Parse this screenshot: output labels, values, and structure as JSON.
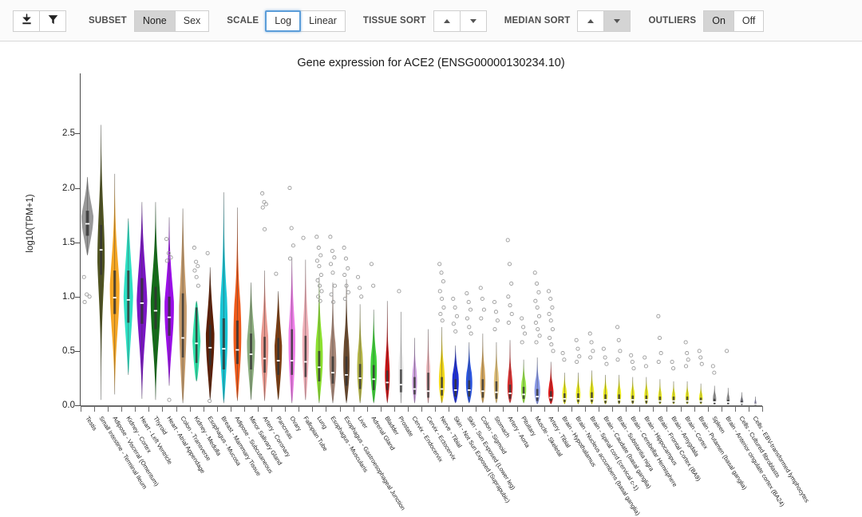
{
  "toolbar": {
    "download_icon": "download-icon",
    "filter_icon": "filter-funnel-icon",
    "subset_label": "SUBSET",
    "subset_options": [
      "None",
      "Sex"
    ],
    "subset_selected": "None",
    "scale_label": "SCALE",
    "scale_options": [
      "Log",
      "Linear"
    ],
    "scale_selected": "Log",
    "tissue_sort_label": "TISSUE SORT",
    "tissue_sort_up": "sort-ascending-icon",
    "tissue_sort_down": "sort-descending-icon",
    "tissue_sort_selected": "none",
    "median_sort_label": "MEDIAN SORT",
    "median_sort_up": "sort-ascending-icon",
    "median_sort_down": "sort-descending-icon",
    "median_sort_selected": "down",
    "outliers_label": "OUTLIERS",
    "outliers_options": [
      "On",
      "Off"
    ],
    "outliers_selected": "On"
  },
  "chart_data": {
    "type": "violin",
    "title": "Gene expression for ACE2 (ENSG00000130234.10)",
    "xlabel": "",
    "ylabel": "log10(TPM+1)",
    "ylim": [
      0.0,
      2.65
    ],
    "yticks": [
      "0.0",
      "0.5",
      "1.0",
      "1.5",
      "2.0",
      "2.5"
    ],
    "ytick_values": [
      0.0,
      0.5,
      1.0,
      1.5,
      2.0,
      2.5
    ],
    "grid": false,
    "legend": "none",
    "sort": "median descending",
    "categories": [
      "Testis",
      "Small Intestine - Terminal Ileum",
      "Adipose - Visceral (Omentum)",
      "Kidney - Cortex",
      "Heart - Left Ventricle",
      "Thyroid",
      "Heart - Atrial Appendage",
      "Colon - Transverse",
      "Kidney - Medulla",
      "Esophagus - Mucosa",
      "Breast - Mammary Tissue",
      "Adipose - Subcutaneous",
      "Minor Salivary Gland",
      "Artery - Coronary",
      "Pancreas",
      "Ovary",
      "Fallopian Tube",
      "Lung",
      "Esophagus - Muscularis",
      "Esophagus - Gastroesophageal Junction",
      "Liver",
      "Adrenal Gland",
      "Bladder",
      "Prostate",
      "Cervix - Endocervix",
      "Cervix - Ectocervix",
      "Nerve - Tibial",
      "Skin - Not Sun Exposed (Suprapubic)",
      "Skin - Sun Exposed (Lower leg)",
      "Colon - Sigmoid",
      "Stomach",
      "Artery - Aorta",
      "Pituitary",
      "Muscle - Skeletal",
      "Artery - Tibial",
      "Brain - Hypothalamus",
      "Brain - Nucleus accumbens (basal ganglia)",
      "Brain - Spinal cord (cervical c-1)",
      "Brain - Caudate (basal ganglia)",
      "Brain - Substantia nigra",
      "Brain - Cerebellar Hemisphere",
      "Brain - Hippocampus",
      "Brain - Frontal Cortex (BA9)",
      "Brain - Amygdala",
      "Brain - Cortex",
      "Brain - Putamen (basal ganglia)",
      "Spleen",
      "Brain - Anterior cingulate cortex (BA24)",
      "Cells - Cultured fibroblasts",
      "Cells - EBV-transformed lymphocytes"
    ],
    "series": [
      {
        "name": "Testis",
        "color": "#999999",
        "median": 1.67,
        "q1": 1.56,
        "q3": 1.79,
        "min": 1.38,
        "max": 2.1,
        "width": 0.5,
        "outliers": [
          1.18,
          1.02,
          1.0,
          0.95
        ]
      },
      {
        "name": "Small Intestine - Terminal Ileum",
        "color": "#4f5320",
        "median": 1.43,
        "q1": 1.2,
        "q3": 1.66,
        "min": 0.05,
        "max": 2.58,
        "width": 0.3,
        "outliers": []
      },
      {
        "name": "Adipose - Visceral (Omentum)",
        "color": "#f6a623",
        "median": 0.99,
        "q1": 0.84,
        "q3": 1.24,
        "min": 0.1,
        "max": 2.13,
        "width": 0.4,
        "outliers": []
      },
      {
        "name": "Kidney - Cortex",
        "color": "#2ee0c4",
        "median": 0.97,
        "q1": 0.76,
        "q3": 1.24,
        "min": 0.28,
        "max": 1.72,
        "width": 0.38,
        "outliers": []
      },
      {
        "name": "Heart - Left Ventricle",
        "color": "#7a16c4",
        "median": 0.94,
        "q1": 0.75,
        "q3": 1.17,
        "min": 0.06,
        "max": 1.87,
        "width": 0.42,
        "outliers": []
      },
      {
        "name": "Thyroid",
        "color": "#136d18",
        "median": 0.87,
        "q1": 0.7,
        "q3": 1.09,
        "min": 0.05,
        "max": 1.87,
        "width": 0.4,
        "outliers": []
      },
      {
        "name": "Heart - Atrial Appendage",
        "color": "#9b0fe8",
        "median": 0.81,
        "q1": 0.64,
        "q3": 1.0,
        "min": 0.18,
        "max": 1.73,
        "width": 0.4,
        "outliers": [
          1.53,
          1.4,
          1.36,
          1.33,
          0.05
        ]
      },
      {
        "name": "Colon - Transverse",
        "color": "#c49a6b",
        "median": 0.62,
        "q1": 0.44,
        "q3": 1.03,
        "min": 0.02,
        "max": 1.81,
        "width": 0.34,
        "outliers": []
      },
      {
        "name": "Kidney - Medulla",
        "color": "#30e0a8",
        "median": 0.57,
        "q1": 0.39,
        "q3": 0.9,
        "min": 0.22,
        "max": 0.96,
        "width": 0.32,
        "outliers": [
          1.45,
          1.32,
          1.28,
          1.24,
          1.18,
          1.1
        ]
      },
      {
        "name": "Esophagus - Mucosa",
        "color": "#5a1f06",
        "median": 0.53,
        "q1": 0.37,
        "q3": 0.74,
        "min": 0.05,
        "max": 1.27,
        "width": 0.36,
        "outliers": [
          1.4,
          0.04
        ]
      },
      {
        "name": "Breast - Mammary Tissue",
        "color": "#19c5d4",
        "median": 0.52,
        "q1": 0.33,
        "q3": 0.8,
        "min": 0.02,
        "max": 1.96,
        "width": 0.4,
        "outliers": []
      },
      {
        "name": "Adipose - Subcutaneous",
        "color": "#ef5a1a",
        "median": 0.51,
        "q1": 0.38,
        "q3": 0.78,
        "min": 0.04,
        "max": 1.82,
        "width": 0.4,
        "outliers": []
      },
      {
        "name": "Minor Salivary Gland",
        "color": "#8aab7c",
        "median": 0.47,
        "q1": 0.33,
        "q3": 0.66,
        "min": 0.05,
        "max": 1.13,
        "width": 0.34,
        "outliers": []
      },
      {
        "name": "Artery - Coronary",
        "color": "#e99a90",
        "median": 0.43,
        "q1": 0.3,
        "q3": 0.63,
        "min": 0.04,
        "max": 1.24,
        "width": 0.34,
        "outliers": [
          1.95,
          1.87,
          1.85,
          1.82,
          1.62
        ]
      },
      {
        "name": "Pancreas",
        "color": "#7b3d12",
        "median": 0.41,
        "q1": 0.28,
        "q3": 0.62,
        "min": 0.05,
        "max": 1.05,
        "width": 0.32,
        "outliers": [
          1.21
        ]
      },
      {
        "name": "Ovary",
        "color": "#ee7ee8",
        "median": 0.41,
        "q1": 0.28,
        "q3": 0.7,
        "min": 0.02,
        "max": 1.36,
        "width": 0.32,
        "outliers": [
          2.0,
          1.63,
          1.47,
          1.35
        ]
      },
      {
        "name": "Fallopian Tube",
        "color": "#f0b0b8",
        "median": 0.4,
        "q1": 0.26,
        "q3": 0.64,
        "min": 0.05,
        "max": 1.34,
        "width": 0.32,
        "outliers": [
          1.54
        ]
      },
      {
        "name": "Lung",
        "color": "#8ce030",
        "median": 0.35,
        "q1": 0.22,
        "q3": 0.5,
        "min": 0.02,
        "max": 1.18,
        "width": 0.36,
        "outliers": [
          1.55,
          1.45,
          1.38,
          1.33,
          1.28,
          1.2,
          1.15,
          1.1,
          1.05,
          1.0,
          0.96
        ]
      },
      {
        "name": "Esophagus - Muscularis",
        "color": "#a88778",
        "median": 0.3,
        "q1": 0.2,
        "q3": 0.45,
        "min": 0.02,
        "max": 1.13,
        "width": 0.36,
        "outliers": [
          1.55,
          1.42,
          1.36,
          1.3,
          1.22,
          1.1,
          1.02,
          0.95
        ]
      },
      {
        "name": "Esophagus - Gastroesophageal Junction",
        "color": "#6b4a2e",
        "median": 0.28,
        "q1": 0.18,
        "q3": 0.45,
        "min": 0.02,
        "max": 1.16,
        "width": 0.34,
        "outliers": [
          1.45,
          1.35,
          1.26,
          1.2,
          1.1,
          1.04,
          0.98
        ]
      },
      {
        "name": "Liver",
        "color": "#b5b648",
        "median": 0.25,
        "q1": 0.15,
        "q3": 0.38,
        "min": 0.02,
        "max": 0.93,
        "width": 0.3,
        "outliers": [
          1.18,
          1.08,
          1.0
        ]
      },
      {
        "name": "Adrenal Gland",
        "color": "#3fd138",
        "median": 0.24,
        "q1": 0.14,
        "q3": 0.37,
        "min": 0.02,
        "max": 0.88,
        "width": 0.32,
        "outliers": [
          1.3,
          1.1
        ]
      },
      {
        "name": "Bladder",
        "color": "#cc1012",
        "median": 0.21,
        "q1": 0.14,
        "q3": 0.32,
        "min": 0.02,
        "max": 0.96,
        "width": 0.28,
        "outliers": []
      },
      {
        "name": "Prostate",
        "color": "#e8e8e8",
        "median": 0.19,
        "q1": 0.12,
        "q3": 0.33,
        "min": 0.02,
        "max": 0.86,
        "width": 0.28,
        "outliers": [
          1.05
        ]
      },
      {
        "name": "Cervix - Endocervix",
        "color": "#cfa3e0",
        "median": 0.15,
        "q1": 0.1,
        "q3": 0.26,
        "min": 0.02,
        "max": 0.62,
        "width": 0.26,
        "outliers": []
      },
      {
        "name": "Cervix - Ectocervix",
        "color": "#f0bcc0",
        "median": 0.13,
        "q1": 0.07,
        "q3": 0.3,
        "min": 0.02,
        "max": 0.7,
        "width": 0.24,
        "outliers": []
      },
      {
        "name": "Nerve - Tibial",
        "color": "#f2d819",
        "median": 0.15,
        "q1": 0.09,
        "q3": 0.26,
        "min": 0.02,
        "max": 0.72,
        "width": 0.34,
        "outliers": [
          1.3,
          1.22,
          1.14,
          1.05,
          0.98,
          0.9,
          0.84,
          0.78
        ]
      },
      {
        "name": "Skin - Not Sun Exposed (Suprapubic)",
        "color": "#1f2fd4",
        "median": 0.14,
        "q1": 0.08,
        "q3": 0.24,
        "min": 0.02,
        "max": 0.55,
        "width": 0.34,
        "outliers": [
          0.98,
          0.9,
          0.82,
          0.75,
          0.68
        ]
      },
      {
        "name": "Skin - Sun Exposed (Lower leg)",
        "color": "#2b55de",
        "median": 0.14,
        "q1": 0.08,
        "q3": 0.23,
        "min": 0.02,
        "max": 0.58,
        "width": 0.34,
        "outliers": [
          1.03,
          0.95,
          0.88,
          0.8,
          0.72,
          0.66
        ]
      },
      {
        "name": "Colon - Sigmoid",
        "color": "#d5a860",
        "median": 0.13,
        "q1": 0.07,
        "q3": 0.24,
        "min": 0.02,
        "max": 0.66,
        "width": 0.3,
        "outliers": [
          1.08,
          0.98,
          0.88,
          0.8
        ]
      },
      {
        "name": "Stomach",
        "color": "#e2c27a",
        "median": 0.12,
        "q1": 0.06,
        "q3": 0.22,
        "min": 0.02,
        "max": 0.58,
        "width": 0.28,
        "outliers": [
          0.95,
          0.86,
          0.78,
          0.7
        ]
      },
      {
        "name": "Artery - Aorta",
        "color": "#d93030",
        "median": 0.11,
        "q1": 0.06,
        "q3": 0.19,
        "min": 0.02,
        "max": 0.6,
        "width": 0.32,
        "outliers": [
          1.52,
          1.3,
          1.12,
          1.0,
          0.92,
          0.84,
          0.76
        ]
      },
      {
        "name": "Pituitary",
        "color": "#9ae84a",
        "median": 0.1,
        "q1": 0.06,
        "q3": 0.17,
        "min": 0.02,
        "max": 0.42,
        "width": 0.28,
        "outliers": [
          0.8,
          0.72,
          0.66,
          0.58
        ]
      },
      {
        "name": "Muscle - Skeletal",
        "color": "#8a9ae8",
        "median": 0.08,
        "q1": 0.04,
        "q3": 0.15,
        "min": 0.01,
        "max": 0.44,
        "width": 0.34,
        "outliers": [
          1.22,
          1.12,
          1.04,
          0.96,
          0.9,
          0.82,
          0.76,
          0.7,
          0.64,
          0.58
        ]
      },
      {
        "name": "Artery - Tibial",
        "color": "#dd1b1b",
        "median": 0.07,
        "q1": 0.04,
        "q3": 0.13,
        "min": 0.01,
        "max": 0.4,
        "width": 0.32,
        "outliers": [
          1.05,
          0.98,
          0.9,
          0.84,
          0.78,
          0.7,
          0.62,
          0.56,
          0.5
        ]
      },
      {
        "name": "Brain - Hypothalamus",
        "color": "#eded22",
        "median": 0.06,
        "q1": 0.03,
        "q3": 0.11,
        "min": 0.01,
        "max": 0.3,
        "width": 0.26,
        "outliers": [
          0.48,
          0.42
        ]
      },
      {
        "name": "Brain - Nucleus accumbens (basal ganglia)",
        "color": "#eded22",
        "median": 0.06,
        "q1": 0.03,
        "q3": 0.11,
        "min": 0.01,
        "max": 0.3,
        "width": 0.26,
        "outliers": [
          0.6,
          0.52,
          0.45,
          0.4
        ]
      },
      {
        "name": "Brain - Spinal cord (cervical c-1)",
        "color": "#eded22",
        "median": 0.06,
        "q1": 0.03,
        "q3": 0.12,
        "min": 0.01,
        "max": 0.32,
        "width": 0.26,
        "outliers": [
          0.66,
          0.58,
          0.5,
          0.44
        ]
      },
      {
        "name": "Brain - Caudate (basal ganglia)",
        "color": "#eded22",
        "median": 0.05,
        "q1": 0.02,
        "q3": 0.1,
        "min": 0.01,
        "max": 0.28,
        "width": 0.26,
        "outliers": [
          0.52,
          0.44,
          0.38
        ]
      },
      {
        "name": "Brain - Substantia nigra",
        "color": "#eded22",
        "median": 0.05,
        "q1": 0.02,
        "q3": 0.1,
        "min": 0.01,
        "max": 0.28,
        "width": 0.24,
        "outliers": [
          0.72,
          0.6,
          0.5,
          0.42
        ]
      },
      {
        "name": "Brain - Cerebellar Hemisphere",
        "color": "#eded22",
        "median": 0.05,
        "q1": 0.02,
        "q3": 0.09,
        "min": 0.01,
        "max": 0.26,
        "width": 0.24,
        "outliers": [
          0.46,
          0.4,
          0.34
        ]
      },
      {
        "name": "Brain - Hippocampus",
        "color": "#eded22",
        "median": 0.05,
        "q1": 0.02,
        "q3": 0.09,
        "min": 0.01,
        "max": 0.26,
        "width": 0.24,
        "outliers": [
          0.44,
          0.36
        ]
      },
      {
        "name": "Brain - Frontal Cortex (BA9)",
        "color": "#eded22",
        "median": 0.04,
        "q1": 0.02,
        "q3": 0.08,
        "min": 0.01,
        "max": 0.24,
        "width": 0.24,
        "outliers": [
          0.82,
          0.62,
          0.48,
          0.4
        ]
      },
      {
        "name": "Brain - Amygdala",
        "color": "#eded22",
        "median": 0.04,
        "q1": 0.02,
        "q3": 0.08,
        "min": 0.01,
        "max": 0.22,
        "width": 0.22,
        "outliers": [
          0.4,
          0.34
        ]
      },
      {
        "name": "Brain - Cortex",
        "color": "#eded22",
        "median": 0.04,
        "q1": 0.02,
        "q3": 0.08,
        "min": 0.01,
        "max": 0.22,
        "width": 0.22,
        "outliers": [
          0.58,
          0.48,
          0.42,
          0.36
        ]
      },
      {
        "name": "Brain - Putamen (basal ganglia)",
        "color": "#eded22",
        "median": 0.04,
        "q1": 0.02,
        "q3": 0.07,
        "min": 0.01,
        "max": 0.2,
        "width": 0.22,
        "outliers": [
          0.5,
          0.44,
          0.38
        ]
      },
      {
        "name": "Spleen",
        "color": "#9a9a9a",
        "median": 0.03,
        "q1": 0.01,
        "q3": 0.06,
        "min": 0.01,
        "max": 0.18,
        "width": 0.22,
        "outliers": [
          0.36,
          0.3
        ]
      },
      {
        "name": "Brain - Anterior cingulate cortex (BA24)",
        "color": "#9a9a9a",
        "median": 0.03,
        "q1": 0.01,
        "q3": 0.05,
        "min": 0.01,
        "max": 0.16,
        "width": 0.2,
        "outliers": [
          0.5
        ]
      },
      {
        "name": "Cells - Cultured fibroblasts",
        "color": "#8c8c96",
        "median": 0.02,
        "q1": 0.01,
        "q3": 0.04,
        "min": 0.0,
        "max": 0.12,
        "width": 0.18,
        "outliers": []
      },
      {
        "name": "Cells - EBV-transformed lymphocytes",
        "color": "#a7a3c4",
        "median": 0.01,
        "q1": 0.0,
        "q3": 0.02,
        "min": 0.0,
        "max": 0.08,
        "width": 0.14,
        "outliers": []
      }
    ]
  }
}
